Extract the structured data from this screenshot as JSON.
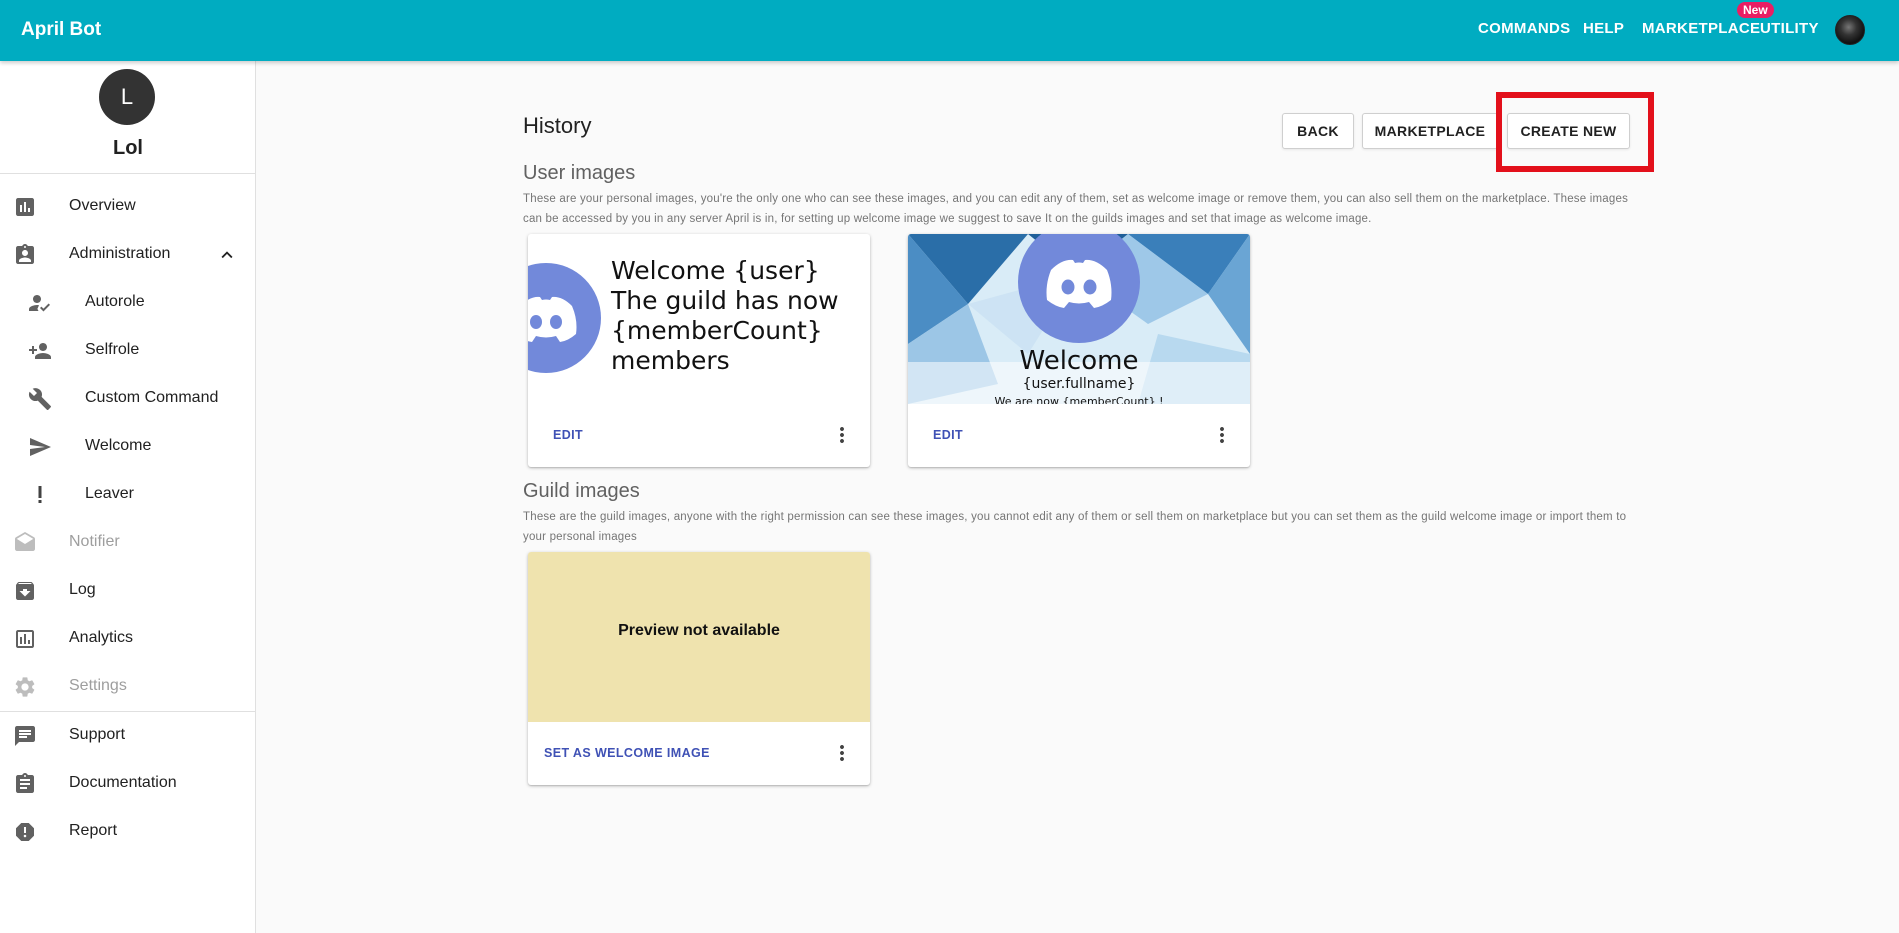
{
  "app": {
    "title": "April Bot"
  },
  "topnav": {
    "commands": "COMMANDS",
    "help": "HELP",
    "marketplace": "MARKETPLACE",
    "marketplace_badge": "New",
    "utility": "UTILITY",
    "avatar_icon": "user-avatar"
  },
  "sidebar": {
    "guild_initial": "L",
    "guild_name": "Lol",
    "items": [
      {
        "label": "Overview",
        "icon": "bar-chart-icon"
      },
      {
        "label": "Administration",
        "icon": "assignment-ind-icon",
        "expanded": true
      },
      {
        "label": "Autorole",
        "icon": "how-to-reg-icon"
      },
      {
        "label": "Selfrole",
        "icon": "person-add-icon"
      },
      {
        "label": "Custom Command",
        "icon": "wrench-icon"
      },
      {
        "label": "Welcome",
        "icon": "send-icon"
      },
      {
        "label": "Leaver",
        "icon": "exclamation-icon"
      },
      {
        "label": "Notifier",
        "icon": "drafts-icon",
        "disabled": true
      },
      {
        "label": "Log",
        "icon": "archive-icon"
      },
      {
        "label": "Analytics",
        "icon": "analytics-icon"
      },
      {
        "label": "Settings",
        "icon": "gear-icon",
        "disabled": true
      },
      {
        "label": "Support",
        "icon": "chat-icon"
      },
      {
        "label": "Documentation",
        "icon": "clipboard-icon"
      },
      {
        "label": "Report",
        "icon": "report-icon"
      }
    ]
  },
  "main": {
    "title": "History",
    "buttons": {
      "back": "BACK",
      "marketplace": "MARKETPLACE",
      "create_new": "CREATE NEW"
    },
    "user_images": {
      "title": "User images",
      "description": "These are your personal images, you're the only one who can see these images, and you can edit any of them, set as welcome image or remove them, you can also sell them on the marketplace. These images can be accessed by you in any server April is in, for setting up welcome image we suggest to save It on the guilds images and set that image as welcome image.",
      "cards": [
        {
          "preview_lines": [
            "Welcome {user}",
            "The guild has now",
            "{memberCount}",
            "members"
          ],
          "action": "EDIT",
          "menu_icon": "more-vert-icon"
        },
        {
          "preview_title": "Welcome",
          "preview_sub": "{user.fullname}",
          "preview_sub2": "We are now {memberCount} !",
          "action": "EDIT",
          "menu_icon": "more-vert-icon"
        }
      ]
    },
    "guild_images": {
      "title": "Guild images",
      "description": "These are the guild images, anyone with the right permission can see these images, you cannot edit any of them or sell them on marketplace but you can set them as the guild welcome image or import them to your personal images",
      "cards": [
        {
          "preview_text": "Preview not available",
          "action": "SET AS WELCOME IMAGE",
          "menu_icon": "more-vert-icon"
        }
      ]
    }
  },
  "colors": {
    "appbar": "#00acc1",
    "badge": "#e91e63",
    "action": "#3f51b5",
    "highlight": "#e3101b",
    "discord": "#7289da",
    "placeholder": "#efe3ae"
  }
}
